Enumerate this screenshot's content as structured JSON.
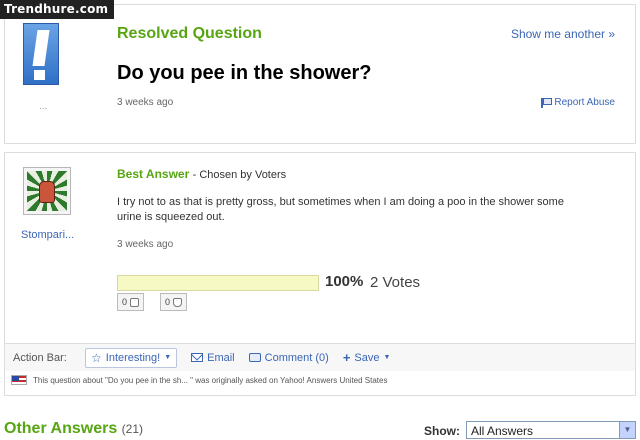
{
  "watermark": "Trendhure.com",
  "question": {
    "status": "Resolved Question",
    "show_another": "Show me another »",
    "title": "Do you pee in the shower?",
    "time": "3 weeks ago",
    "report_label": "Report Abuse",
    "asker_name": "..."
  },
  "best_answer": {
    "label": "Best Answer",
    "chosen": "- Chosen by Voters",
    "answerer_name": "Stompari...",
    "text": "I try not to as that is pretty gross, but sometimes when I am doing a poo in the shower some urine is squeezed out.",
    "time": "3 weeks ago",
    "vote_percent_value": 100,
    "vote_percent": "100%",
    "votes": "2 Votes",
    "thumbs_up_count": "0",
    "thumbs_down_count": "0"
  },
  "action_bar": {
    "label": "Action Bar:",
    "interesting": "Interesting!",
    "email": "Email",
    "comment": "Comment (0)",
    "save": "Save"
  },
  "origin_note": "This question about \"Do you pee in the sh... \" was originally asked on Yahoo! Answers United States",
  "other_answers": {
    "title": "Other Answers",
    "count": "(21)",
    "show_label": "Show:",
    "show_selected": "All Answers"
  },
  "colors": {
    "accent_green": "#57a513",
    "link_blue": "#3b66b5",
    "vote_fill": "#f6f9c4"
  }
}
